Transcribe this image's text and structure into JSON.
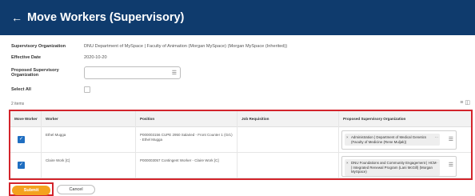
{
  "header": {
    "back_icon": "arrow-left-icon",
    "title": "Move Workers (Supervisory)",
    "background": "#0f3b6d"
  },
  "form": {
    "supervisory_org_label": "Supervisory Organization",
    "supervisory_org_value": "DNU Department of MySpace | Faculty of Animation (Morgan MySpace) (Morgan MySpace (Inherited))",
    "effective_date_label": "Effective Date",
    "effective_date_value": "2020-10-20",
    "proposed_org_label": "Proposed Supervisory Organization",
    "proposed_org_value": "",
    "select_all_label": "Select All",
    "select_all_checked": false
  },
  "table": {
    "item_count": "2 items",
    "columns": [
      "Move Worker",
      "Worker",
      "Position",
      "Job Requisition",
      "Proposed Supervisory Organization"
    ],
    "rows": [
      {
        "checked": true,
        "worker": "Ethel Mugga",
        "position": "P000003156 CUPE 2950 Salaried - Front Counter 1 (Gr1) - Ethel Mugga",
        "job_requisition": "",
        "proposed_org": "Administration | Department of Medical Genetics (Faculty of Medicine (Rene Muljak))"
      },
      {
        "checked": true,
        "worker": "Claire Work [C]",
        "position": "P000003057 Contingent Worker - Claire Work [C]",
        "job_requisition": "",
        "proposed_org": "DNU Foundations and Community Engagement | HCM | Integrated Renewal Program (Lani McGill) (Morgan MySpace)"
      }
    ]
  },
  "actions": {
    "submit_label": "Submit",
    "cancel_label": "Cancel",
    "submit_color": "#f4a21f",
    "highlight_color": "#d3242b"
  }
}
